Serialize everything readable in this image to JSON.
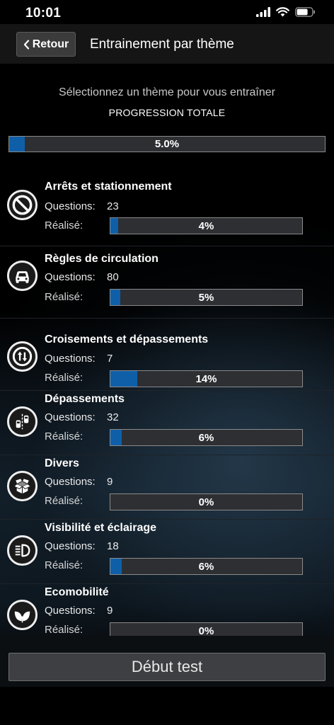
{
  "status": {
    "time": "10:01"
  },
  "nav": {
    "back_label": "Retour",
    "title": "Entrainement par thème"
  },
  "header": {
    "subtitle": "Sélectionnez un thème pour vous entraîner",
    "total_label": "PROGRESSION TOTALE",
    "total_percent_text": "5.0%",
    "total_fraction": 0.05
  },
  "labels": {
    "questions": "Questions:",
    "done": "Réalisé:"
  },
  "themes": [
    {
      "title": "Arrêts et stationnement",
      "questions": "23",
      "percent_text": "4%",
      "fraction": 0.04,
      "icon": "no-stopping-icon"
    },
    {
      "title": "Règles de circulation",
      "questions": "80",
      "percent_text": "5%",
      "fraction": 0.05,
      "icon": "car-icon"
    },
    {
      "title": "Croisements et dépassements",
      "questions": "7",
      "percent_text": "14%",
      "fraction": 0.14,
      "icon": "two-way-arrows-icon"
    },
    {
      "title": "Dépassements",
      "questions": "32",
      "percent_text": "6%",
      "fraction": 0.06,
      "icon": "overtaking-cars-icon"
    },
    {
      "title": "Divers",
      "questions": "9",
      "percent_text": "0%",
      "fraction": 0.0,
      "icon": "open-box-icon"
    },
    {
      "title": "Visibilité et éclairage",
      "questions": "18",
      "percent_text": "6%",
      "fraction": 0.06,
      "icon": "headlight-icon"
    },
    {
      "title": "Ecomobilité",
      "questions": "9",
      "percent_text": "0%",
      "fraction": 0.0,
      "icon": "leaf-icon"
    }
  ],
  "footer": {
    "start_label": "Début test"
  },
  "colors": {
    "accent": "#0f5fa8",
    "bar_bg": "#2e2f33"
  }
}
